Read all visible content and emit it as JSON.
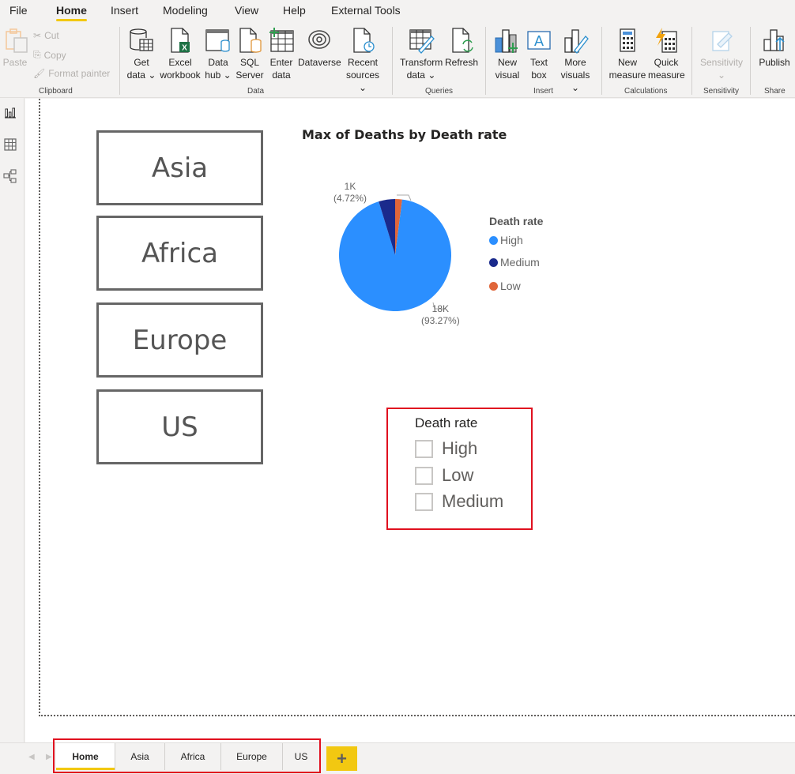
{
  "menu": {
    "items": [
      "File",
      "Home",
      "Insert",
      "Modeling",
      "View",
      "Help",
      "External Tools"
    ],
    "active": "Home"
  },
  "ribbon": {
    "clipboard": {
      "group_label": "Clipboard",
      "paste": "Paste",
      "cut": "Cut",
      "copy": "Copy",
      "format_painter": "Format painter"
    },
    "data": {
      "group_label": "Data",
      "get_data": [
        "Get",
        "data ⌄"
      ],
      "excel": [
        "Excel",
        "workbook"
      ],
      "data_hub": [
        "Data",
        "hub ⌄"
      ],
      "sql": [
        "SQL",
        "Server"
      ],
      "enter_data": [
        "Enter",
        "data"
      ],
      "dataverse": [
        "Dataverse",
        ""
      ],
      "recent": [
        "Recent",
        "sources ⌄"
      ]
    },
    "queries": {
      "group_label": "Queries",
      "transform": [
        "Transform",
        "data ⌄"
      ],
      "refresh": [
        "Refresh",
        ""
      ]
    },
    "insert": {
      "group_label": "Insert",
      "new_visual": [
        "New",
        "visual"
      ],
      "text_box": [
        "Text",
        "box"
      ],
      "more_visuals": [
        "More",
        "visuals ⌄"
      ]
    },
    "calculations": {
      "group_label": "Calculations",
      "new_measure": [
        "New",
        "measure"
      ],
      "quick_measure": [
        "Quick",
        "measure"
      ]
    },
    "sensitivity": {
      "group_label": "Sensitivity",
      "sensitivity": [
        "Sensitivity",
        "⌄"
      ]
    },
    "share": {
      "group_label": "Share",
      "publish": [
        "Publish",
        ""
      ]
    }
  },
  "rail": {
    "icons": [
      "report-view-icon",
      "data-view-icon",
      "model-view-icon"
    ]
  },
  "canvas": {
    "region_buttons": [
      "Asia",
      "Africa",
      "Europe",
      "US"
    ],
    "slicer": {
      "title": "Death rate",
      "items": [
        {
          "label": "High",
          "checked": false
        },
        {
          "label": "Low",
          "checked": false
        },
        {
          "label": "Medium",
          "checked": false
        }
      ]
    }
  },
  "chart_data": {
    "type": "pie",
    "title": "Max of Deaths by Death rate",
    "legend_title": "Death rate",
    "legend_position": "right",
    "categories": [
      "High",
      "Medium",
      "Low"
    ],
    "percentages": [
      93.27,
      4.72,
      2.01
    ],
    "colors": [
      "#2b8fff",
      "#1a2a8c",
      "#e0663a"
    ],
    "data_labels": [
      {
        "category": "High",
        "value": "18K",
        "percent": "(93.27%)"
      },
      {
        "category": "Medium",
        "value": "1K",
        "percent": "(4.72%)"
      }
    ]
  },
  "tabs": {
    "pages": [
      "Home",
      "Asia",
      "Africa",
      "Europe",
      "US"
    ],
    "active": "Home",
    "add_label": "+"
  }
}
